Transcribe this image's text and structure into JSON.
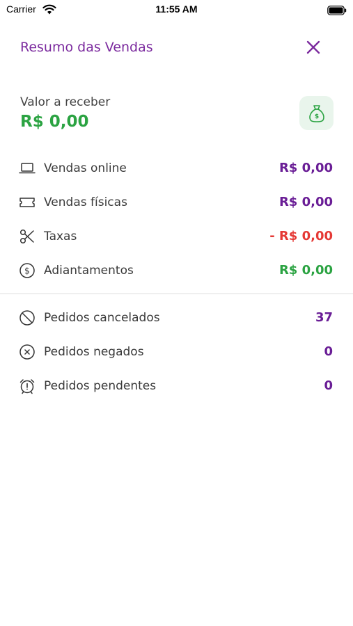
{
  "status_bar": {
    "carrier": "Carrier",
    "time": "11:55 AM"
  },
  "header": {
    "title": "Resumo das Vendas",
    "close_icon": "close-icon"
  },
  "balance": {
    "label": "Valor a receber",
    "value": "R$ 0,00",
    "icon": "money-bag-icon",
    "accent": "#2BA342"
  },
  "summary": [
    {
      "icon": "laptop-icon",
      "label": "Vendas online",
      "value": "R$ 0,00",
      "color": "#6A1E96"
    },
    {
      "icon": "ticket-icon",
      "label": "Vendas físicas",
      "value": "R$ 0,00",
      "color": "#6A1E96"
    },
    {
      "icon": "scissors-icon",
      "label": "Taxas",
      "value": "- R$ 0,00",
      "color": "#E53935"
    },
    {
      "icon": "coin-dollar-icon",
      "label": "Adiantamentos",
      "value": "R$ 0,00",
      "color": "#2BA342"
    }
  ],
  "orders": [
    {
      "icon": "ban-icon",
      "label": "Pedidos cancelados",
      "value": "37",
      "color": "#6A1E96"
    },
    {
      "icon": "x-circle-icon",
      "label": "Pedidos negados",
      "value": "0",
      "color": "#6A1E96"
    },
    {
      "icon": "alarm-clock-icon",
      "label": "Pedidos pendentes",
      "value": "0",
      "color": "#6A1E96"
    }
  ],
  "colors": {
    "brand": "#7B2A9E",
    "purple_value": "#6A1E96",
    "green": "#2BA342",
    "red": "#E53935"
  }
}
